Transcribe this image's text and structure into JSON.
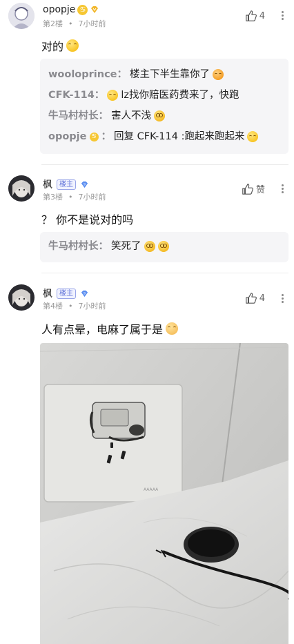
{
  "posts": [
    {
      "username": "opopje",
      "floor": "第2楼",
      "time": "7小时前",
      "likes": "4",
      "content": "对的",
      "replies": [
        {
          "who": "wooloprince：",
          "text": "楼主下半生靠你了"
        },
        {
          "who": "CFK-114：",
          "text": "lz找你赔医药费来了，快跑"
        },
        {
          "who": "牛马村村长：",
          "text": "害人不浅"
        },
        {
          "who": "opopje",
          "sep": "：",
          "text": "回复 CFK-114 :跑起来跑起来"
        }
      ]
    },
    {
      "username": "枫",
      "tag": "楼主",
      "floor": "第3楼",
      "time": "7小时前",
      "likes": "赞",
      "content": "？ 你不是说对的吗",
      "replies": [
        {
          "who": "牛马村村长：",
          "text": "笑死了"
        }
      ]
    },
    {
      "username": "枫",
      "tag": "楼主",
      "floor": "第4楼",
      "time": "7小时前",
      "likes": "4",
      "content": "人有点晕，电麻了属于是"
    }
  ],
  "meta_dot": "•",
  "colors": {
    "reply_name": "#8a8a8f",
    "reply_bg": "#f5f5f7",
    "tag": "#5b6ed6"
  }
}
